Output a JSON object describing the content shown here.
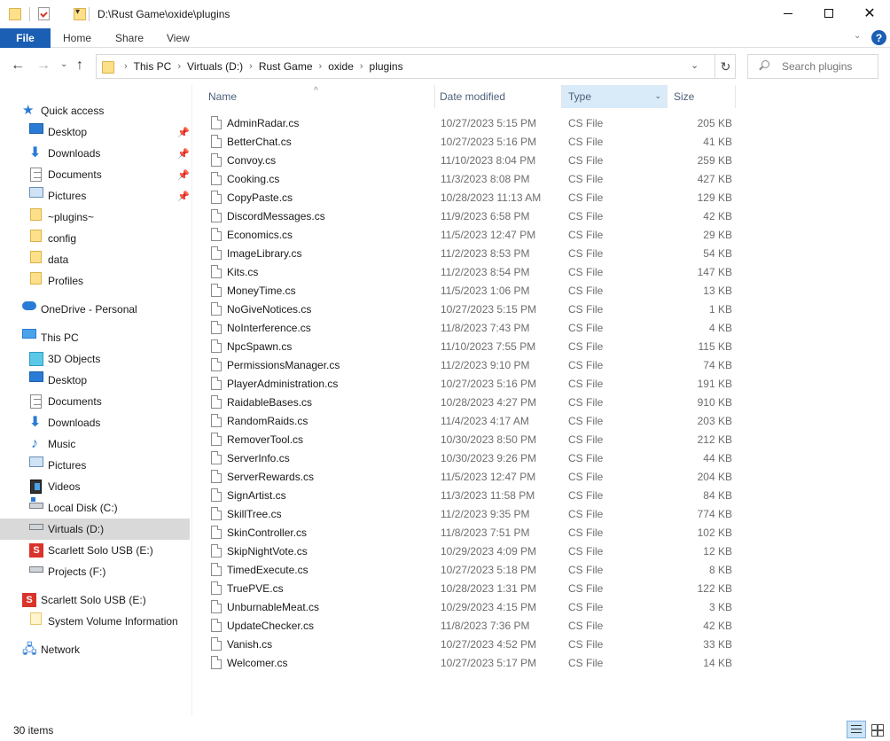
{
  "window": {
    "title": "D:\\Rust Game\\oxide\\plugins"
  },
  "ribbon": {
    "file_label": "File",
    "tabs": [
      "Home",
      "Share",
      "View"
    ],
    "help_label": "?"
  },
  "address": {
    "crumbs": [
      "This PC",
      "Virtuals (D:)",
      "Rust Game",
      "oxide",
      "plugins"
    ]
  },
  "search": {
    "placeholder": "Search plugins"
  },
  "sidebar": {
    "quick_access": "Quick access",
    "quick_items": [
      "Desktop",
      "Downloads",
      "Documents",
      "Pictures",
      "~plugins~",
      "config",
      "data",
      "Profiles"
    ],
    "onedrive": "OneDrive - Personal",
    "this_pc": "This PC",
    "pc_items": [
      "3D Objects",
      "Desktop",
      "Documents",
      "Downloads",
      "Music",
      "Pictures",
      "Videos",
      "Local Disk (C:)",
      "Virtuals (D:)",
      "Scarlett Solo USB (E:)",
      "Projects (F:)"
    ],
    "scarlett_root": "Scarlett Solo USB (E:)",
    "scarlett_child": "System Volume Information",
    "network": "Network"
  },
  "columns": {
    "name": "Name",
    "date": "Date modified",
    "type": "Type",
    "size": "Size"
  },
  "files": [
    {
      "name": "AdminRadar.cs",
      "date": "10/27/2023 5:15 PM",
      "type": "CS File",
      "size": "205 KB"
    },
    {
      "name": "BetterChat.cs",
      "date": "10/27/2023 5:16 PM",
      "type": "CS File",
      "size": "41 KB"
    },
    {
      "name": "Convoy.cs",
      "date": "11/10/2023 8:04 PM",
      "type": "CS File",
      "size": "259 KB"
    },
    {
      "name": "Cooking.cs",
      "date": "11/3/2023 8:08 PM",
      "type": "CS File",
      "size": "427 KB"
    },
    {
      "name": "CopyPaste.cs",
      "date": "10/28/2023 11:13 AM",
      "type": "CS File",
      "size": "129 KB"
    },
    {
      "name": "DiscordMessages.cs",
      "date": "11/9/2023 6:58 PM",
      "type": "CS File",
      "size": "42 KB"
    },
    {
      "name": "Economics.cs",
      "date": "11/5/2023 12:47 PM",
      "type": "CS File",
      "size": "29 KB"
    },
    {
      "name": "ImageLibrary.cs",
      "date": "11/2/2023 8:53 PM",
      "type": "CS File",
      "size": "54 KB"
    },
    {
      "name": "Kits.cs",
      "date": "11/2/2023 8:54 PM",
      "type": "CS File",
      "size": "147 KB"
    },
    {
      "name": "MoneyTime.cs",
      "date": "11/5/2023 1:06 PM",
      "type": "CS File",
      "size": "13 KB"
    },
    {
      "name": "NoGiveNotices.cs",
      "date": "10/27/2023 5:15 PM",
      "type": "CS File",
      "size": "1 KB"
    },
    {
      "name": "NoInterference.cs",
      "date": "11/8/2023 7:43 PM",
      "type": "CS File",
      "size": "4 KB"
    },
    {
      "name": "NpcSpawn.cs",
      "date": "11/10/2023 7:55 PM",
      "type": "CS File",
      "size": "115 KB"
    },
    {
      "name": "PermissionsManager.cs",
      "date": "11/2/2023 9:10 PM",
      "type": "CS File",
      "size": "74 KB"
    },
    {
      "name": "PlayerAdministration.cs",
      "date": "10/27/2023 5:16 PM",
      "type": "CS File",
      "size": "191 KB"
    },
    {
      "name": "RaidableBases.cs",
      "date": "10/28/2023 4:27 PM",
      "type": "CS File",
      "size": "910 KB"
    },
    {
      "name": "RandomRaids.cs",
      "date": "11/4/2023 4:17 AM",
      "type": "CS File",
      "size": "203 KB"
    },
    {
      "name": "RemoverTool.cs",
      "date": "10/30/2023 8:50 PM",
      "type": "CS File",
      "size": "212 KB"
    },
    {
      "name": "ServerInfo.cs",
      "date": "10/30/2023 9:26 PM",
      "type": "CS File",
      "size": "44 KB"
    },
    {
      "name": "ServerRewards.cs",
      "date": "11/5/2023 12:47 PM",
      "type": "CS File",
      "size": "204 KB"
    },
    {
      "name": "SignArtist.cs",
      "date": "11/3/2023 11:58 PM",
      "type": "CS File",
      "size": "84 KB"
    },
    {
      "name": "SkillTree.cs",
      "date": "11/2/2023 9:35 PM",
      "type": "CS File",
      "size": "774 KB"
    },
    {
      "name": "SkinController.cs",
      "date": "11/8/2023 7:51 PM",
      "type": "CS File",
      "size": "102 KB"
    },
    {
      "name": "SkipNightVote.cs",
      "date": "10/29/2023 4:09 PM",
      "type": "CS File",
      "size": "12 KB"
    },
    {
      "name": "TimedExecute.cs",
      "date": "10/27/2023 5:18 PM",
      "type": "CS File",
      "size": "8 KB"
    },
    {
      "name": "TruePVE.cs",
      "date": "10/28/2023 1:31 PM",
      "type": "CS File",
      "size": "122 KB"
    },
    {
      "name": "UnburnableMeat.cs",
      "date": "10/29/2023 4:15 PM",
      "type": "CS File",
      "size": "3 KB"
    },
    {
      "name": "UpdateChecker.cs",
      "date": "11/8/2023 7:36 PM",
      "type": "CS File",
      "size": "42 KB"
    },
    {
      "name": "Vanish.cs",
      "date": "10/27/2023 4:52 PM",
      "type": "CS File",
      "size": "33 KB"
    },
    {
      "name": "Welcomer.cs",
      "date": "10/27/2023 5:17 PM",
      "type": "CS File",
      "size": "14 KB"
    }
  ],
  "status": {
    "item_count": "30 items"
  },
  "colors": {
    "accent": "#1a5fb4",
    "selected_sidebar": "#d9d9d9",
    "sorted_column": "#d9eaf9"
  }
}
